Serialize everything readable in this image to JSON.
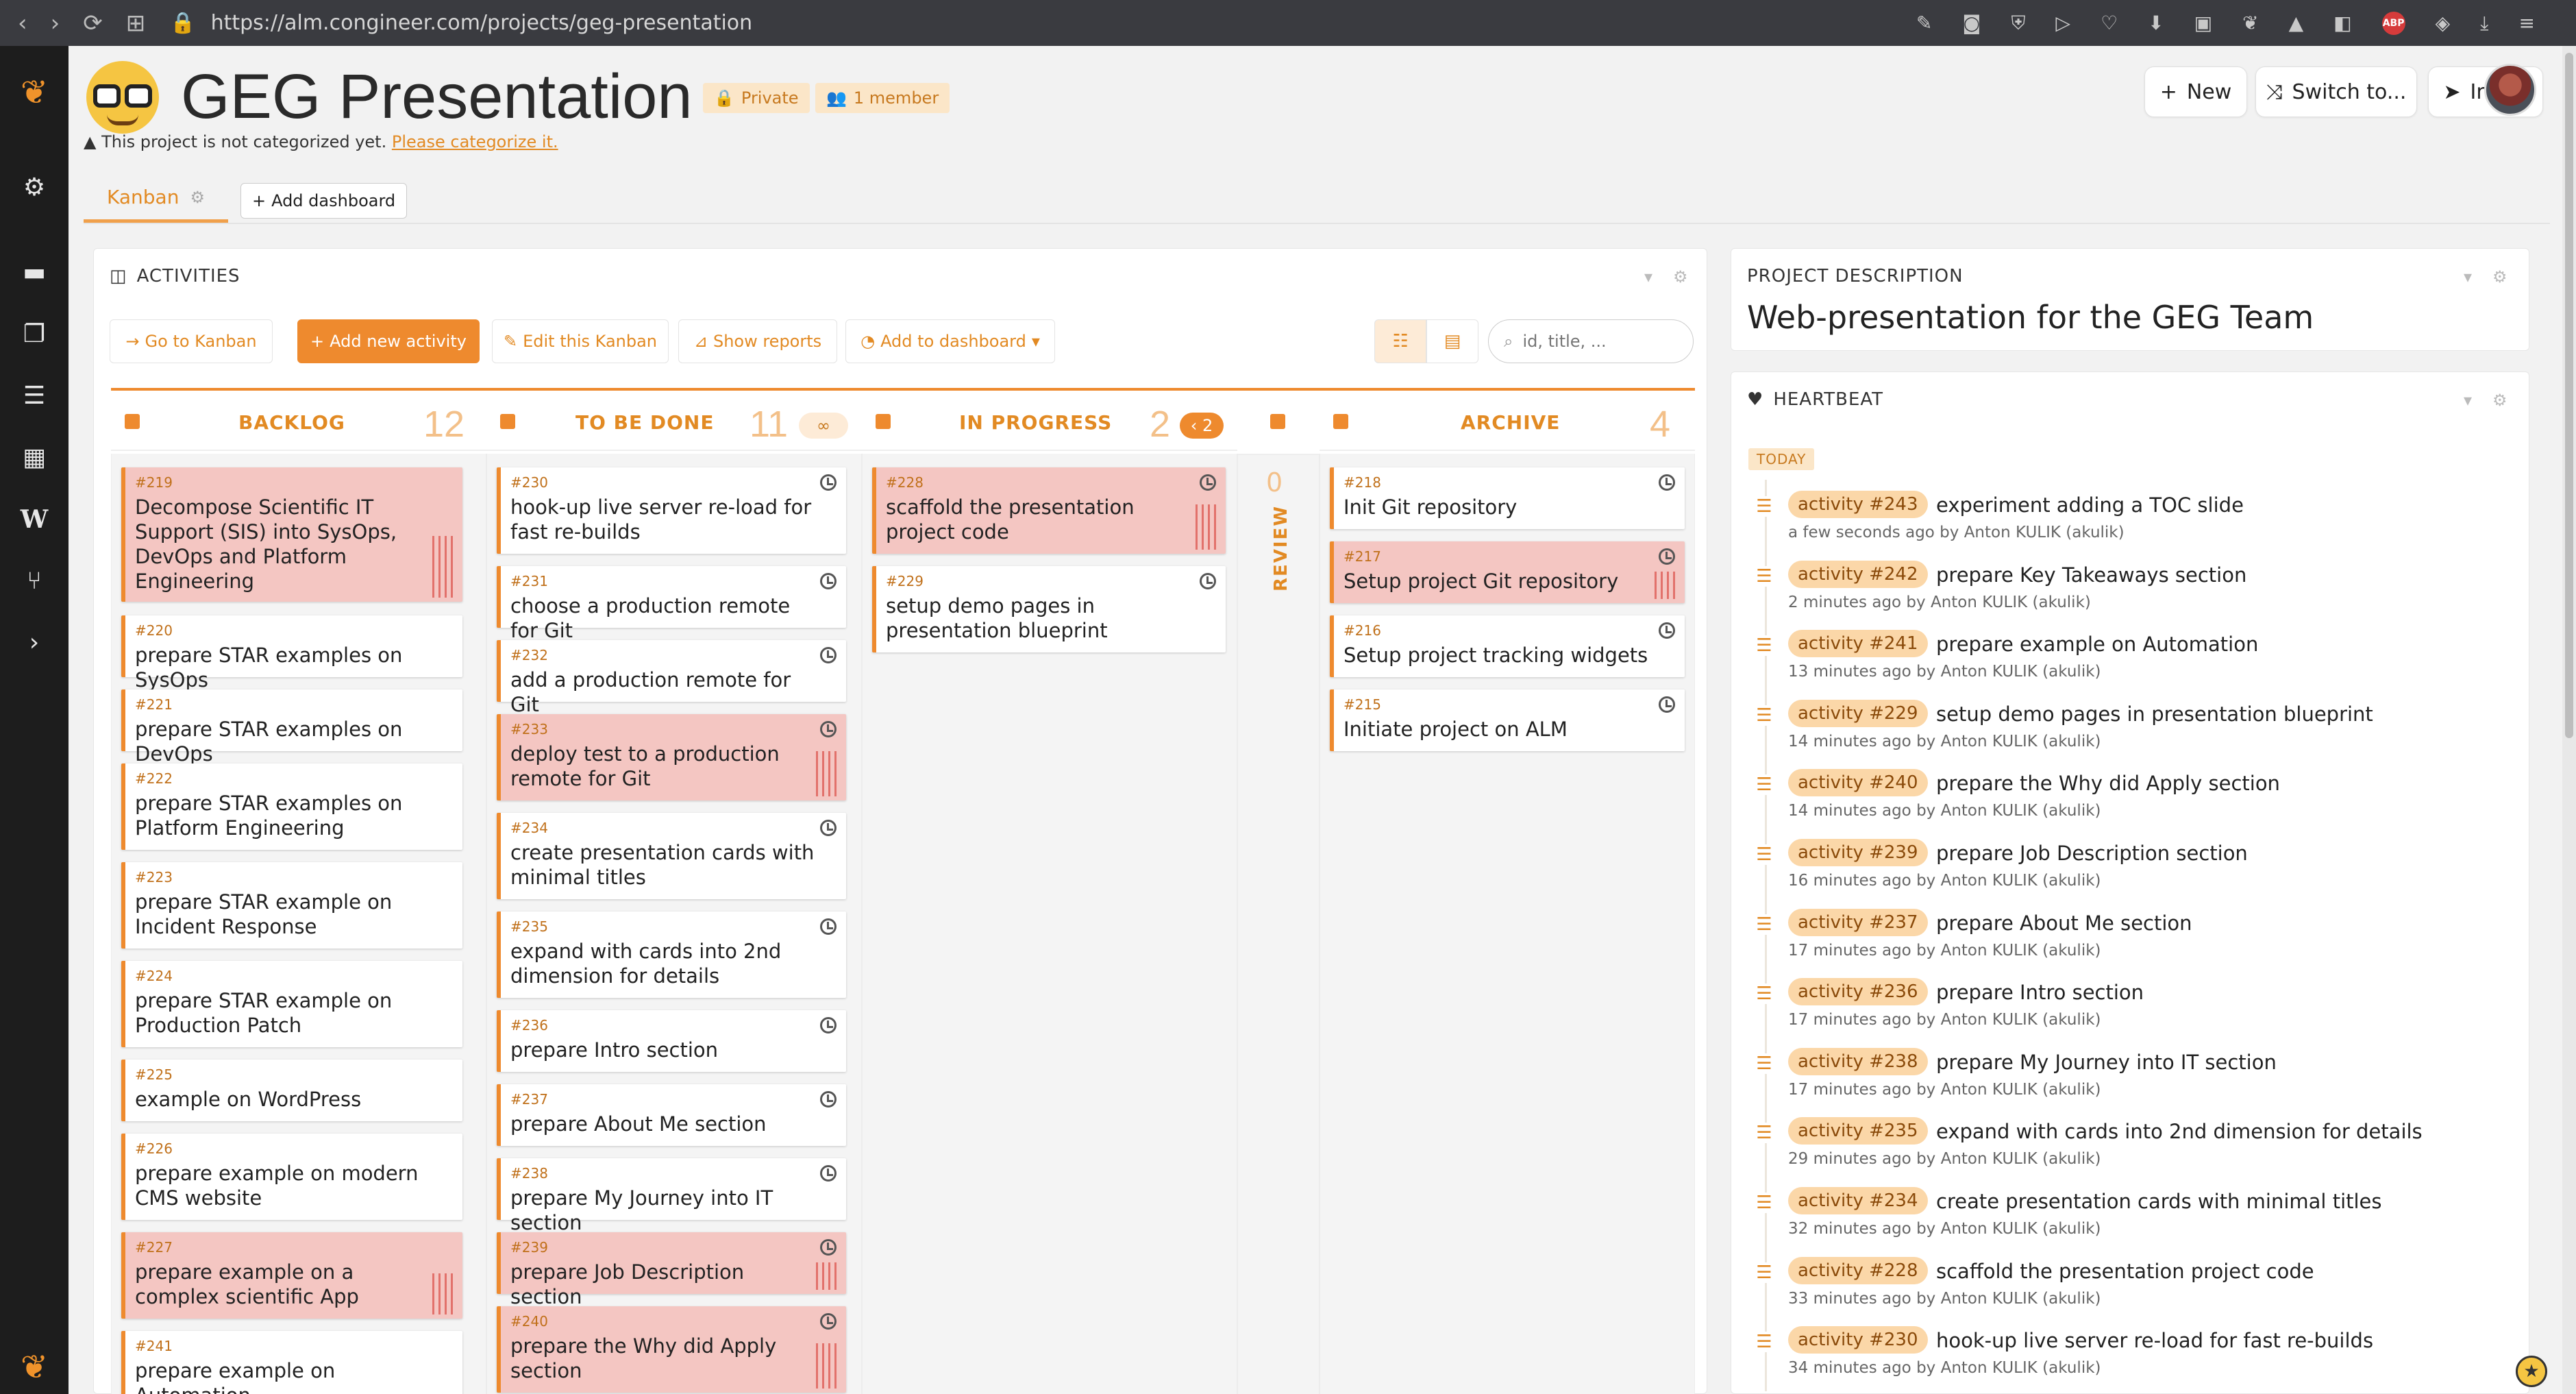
{
  "browser": {
    "url": "https://alm.congineer.com/projects/geg-presentation",
    "back_icon": "‹",
    "forward_icon": "›",
    "reload_icon": "⟳",
    "abp_label": "ABP"
  },
  "header": {
    "title": "GEG Presentation",
    "privacy_badge": "Private",
    "members_badge": "1 member",
    "warning_text": "This project is not categorized yet.",
    "warning_link": "Please categorize it.",
    "new_button": "New",
    "switch_button": "Switch to...",
    "invite_button": "Invite"
  },
  "tabs": {
    "kanban_label": "Kanban",
    "add_dashboard_label": "Add dashboard"
  },
  "activities": {
    "panel_title": "ACTIVITIES",
    "go_to_kanban": "Go to Kanban",
    "add_new_activity": "Add new activity",
    "edit_kanban": "Edit this Kanban",
    "show_reports": "Show reports",
    "add_to_dashboard": "Add to dashboard",
    "search_placeholder": "id, title, ..."
  },
  "kanban": {
    "columns": [
      {
        "name": "BACKLOG",
        "count": "12",
        "badge": ""
      },
      {
        "name": "TO BE DONE",
        "count": "11",
        "badge": "∞"
      },
      {
        "name": "IN PROGRESS",
        "count": "2",
        "badge": "‹ 2"
      },
      {
        "name": "REVIEW",
        "count": "0",
        "badge": ""
      },
      {
        "name": "ARCHIVE",
        "count": "4",
        "badge": ""
      }
    ],
    "backlog": [
      {
        "id": "#219",
        "title": "Decompose Scientific IT Support (SIS) into SysOps, DevOps and Platform Engineering"
      },
      {
        "id": "#220",
        "title": "prepare STAR examples on SysOps"
      },
      {
        "id": "#221",
        "title": "prepare STAR examples on DevOps"
      },
      {
        "id": "#222",
        "title": "prepare STAR examples on Platform Engineering"
      },
      {
        "id": "#223",
        "title": "prepare STAR example on Incident Response"
      },
      {
        "id": "#224",
        "title": "prepare STAR example on Production Patch"
      },
      {
        "id": "#225",
        "title": "example on WordPress"
      },
      {
        "id": "#226",
        "title": "prepare example on modern CMS website"
      },
      {
        "id": "#227",
        "title": "prepare example on a complex scientific App"
      },
      {
        "id": "#241",
        "title": "prepare example on Automation"
      }
    ],
    "todo": [
      {
        "id": "#230",
        "title": "hook-up live server re-load for fast re-builds"
      },
      {
        "id": "#231",
        "title": "choose a production remote for Git"
      },
      {
        "id": "#232",
        "title": "add a production remote for Git"
      },
      {
        "id": "#233",
        "title": "deploy test to a production remote for Git"
      },
      {
        "id": "#234",
        "title": "create presentation cards with minimal titles"
      },
      {
        "id": "#235",
        "title": "expand with cards into 2nd dimension for details"
      },
      {
        "id": "#236",
        "title": "prepare Intro section"
      },
      {
        "id": "#237",
        "title": "prepare About Me section"
      },
      {
        "id": "#238",
        "title": "prepare My Journey into IT section"
      },
      {
        "id": "#239",
        "title": "prepare Job Description section"
      },
      {
        "id": "#240",
        "title": "prepare the Why did Apply section"
      }
    ],
    "in_progress": [
      {
        "id": "#228",
        "title": "scaffold the presentation project code"
      },
      {
        "id": "#229",
        "title": "setup demo pages in presentation blueprint"
      }
    ],
    "archive": [
      {
        "id": "#218",
        "title": "Init Git repository"
      },
      {
        "id": "#217",
        "title": "Setup project Git repository"
      },
      {
        "id": "#216",
        "title": "Setup project tracking widgets"
      },
      {
        "id": "#215",
        "title": "Initiate project on ALM"
      }
    ]
  },
  "description": {
    "panel_title": "PROJECT DESCRIPTION",
    "text": "Web-presentation for the GEG Team"
  },
  "heartbeat": {
    "panel_title": "HEARTBEAT",
    "today_label": "TODAY",
    "items": [
      {
        "badge": "activity #243",
        "title": "experiment adding a TOC slide",
        "meta": "a few seconds ago by Anton KULIK (akulik)"
      },
      {
        "badge": "activity #242",
        "title": "prepare Key Takeaways section",
        "meta": "2 minutes ago by Anton KULIK (akulik)"
      },
      {
        "badge": "activity #241",
        "title": "prepare example on Automation",
        "meta": "13 minutes ago by Anton KULIK (akulik)"
      },
      {
        "badge": "activity #229",
        "title": "setup demo pages in presentation blueprint",
        "meta": "14 minutes ago by Anton KULIK (akulik)"
      },
      {
        "badge": "activity #240",
        "title": "prepare the Why did Apply section",
        "meta": "14 minutes ago by Anton KULIK (akulik)"
      },
      {
        "badge": "activity #239",
        "title": "prepare Job Description section",
        "meta": "16 minutes ago by Anton KULIK (akulik)"
      },
      {
        "badge": "activity #237",
        "title": "prepare About Me section",
        "meta": "17 minutes ago by Anton KULIK (akulik)"
      },
      {
        "badge": "activity #236",
        "title": "prepare Intro section",
        "meta": "17 minutes ago by Anton KULIK (akulik)"
      },
      {
        "badge": "activity #238",
        "title": "prepare My Journey into IT section",
        "meta": "17 minutes ago by Anton KULIK (akulik)"
      },
      {
        "badge": "activity #235",
        "title": "expand with cards into 2nd dimension for details",
        "meta": "29 minutes ago by Anton KULIK (akulik)"
      },
      {
        "badge": "activity #234",
        "title": "create presentation cards with minimal titles",
        "meta": "32 minutes ago by Anton KULIK (akulik)"
      },
      {
        "badge": "activity #228",
        "title": "scaffold the presentation project code",
        "meta": "33 minutes ago by Anton KULIK (akulik)"
      },
      {
        "badge": "activity #230",
        "title": "hook-up live server re-load for fast re-builds",
        "meta": "34 minutes ago by Anton KULIK (akulik)"
      }
    ]
  },
  "colors": {
    "accent": "#ee8a2e",
    "alert_card": "#f4c6c2",
    "sidebar": "#1d1d1d"
  }
}
